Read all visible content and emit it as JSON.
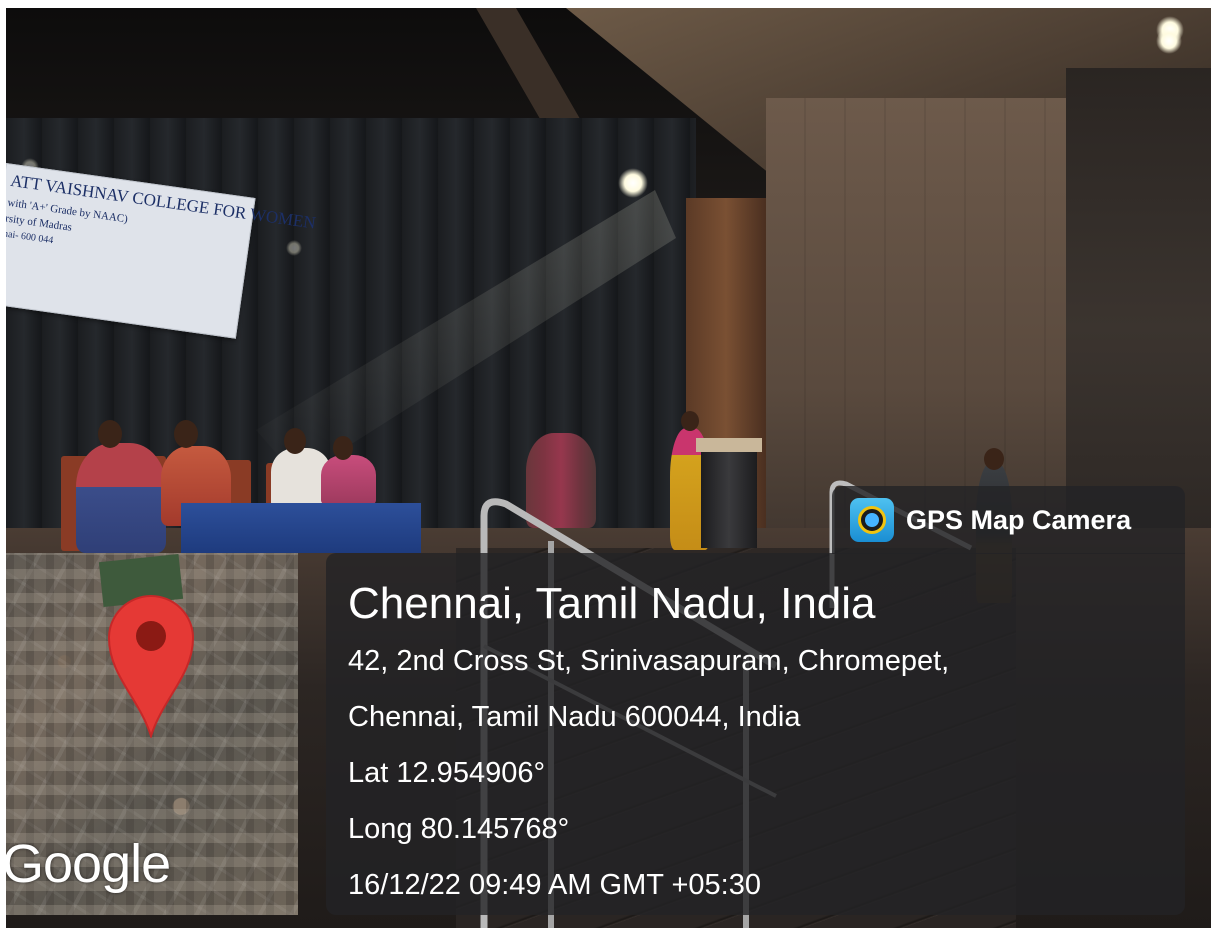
{
  "scene": {
    "description_icons": [
      "stage-photo"
    ],
    "banner": {
      "line1": "ATT VAISHNAV COLLEGE FOR WOMEN",
      "line2": "with 'A+' Grade by NAAC)",
      "line3": "rsity of Madras",
      "line4": "nai- 600 044"
    }
  },
  "overlay": {
    "app_name": "GPS Map Camera",
    "app_icon": "gps-camera-icon",
    "map_icon": "map-pin-icon",
    "map_provider": "Google",
    "location_title": "Chennai, Tamil Nadu, India",
    "address_line1": "42, 2nd Cross St, Srinivasapuram, Chromepet,",
    "address_line2": "Chennai, Tamil Nadu 600044, India",
    "latitude": "Lat 12.954906°",
    "longitude": "Long 80.145768°",
    "timestamp": "16/12/22 09:49 AM GMT +05:30",
    "colors": {
      "pin": "#e53935",
      "pin_dot": "#8b1a14",
      "panel": "#232326"
    }
  }
}
